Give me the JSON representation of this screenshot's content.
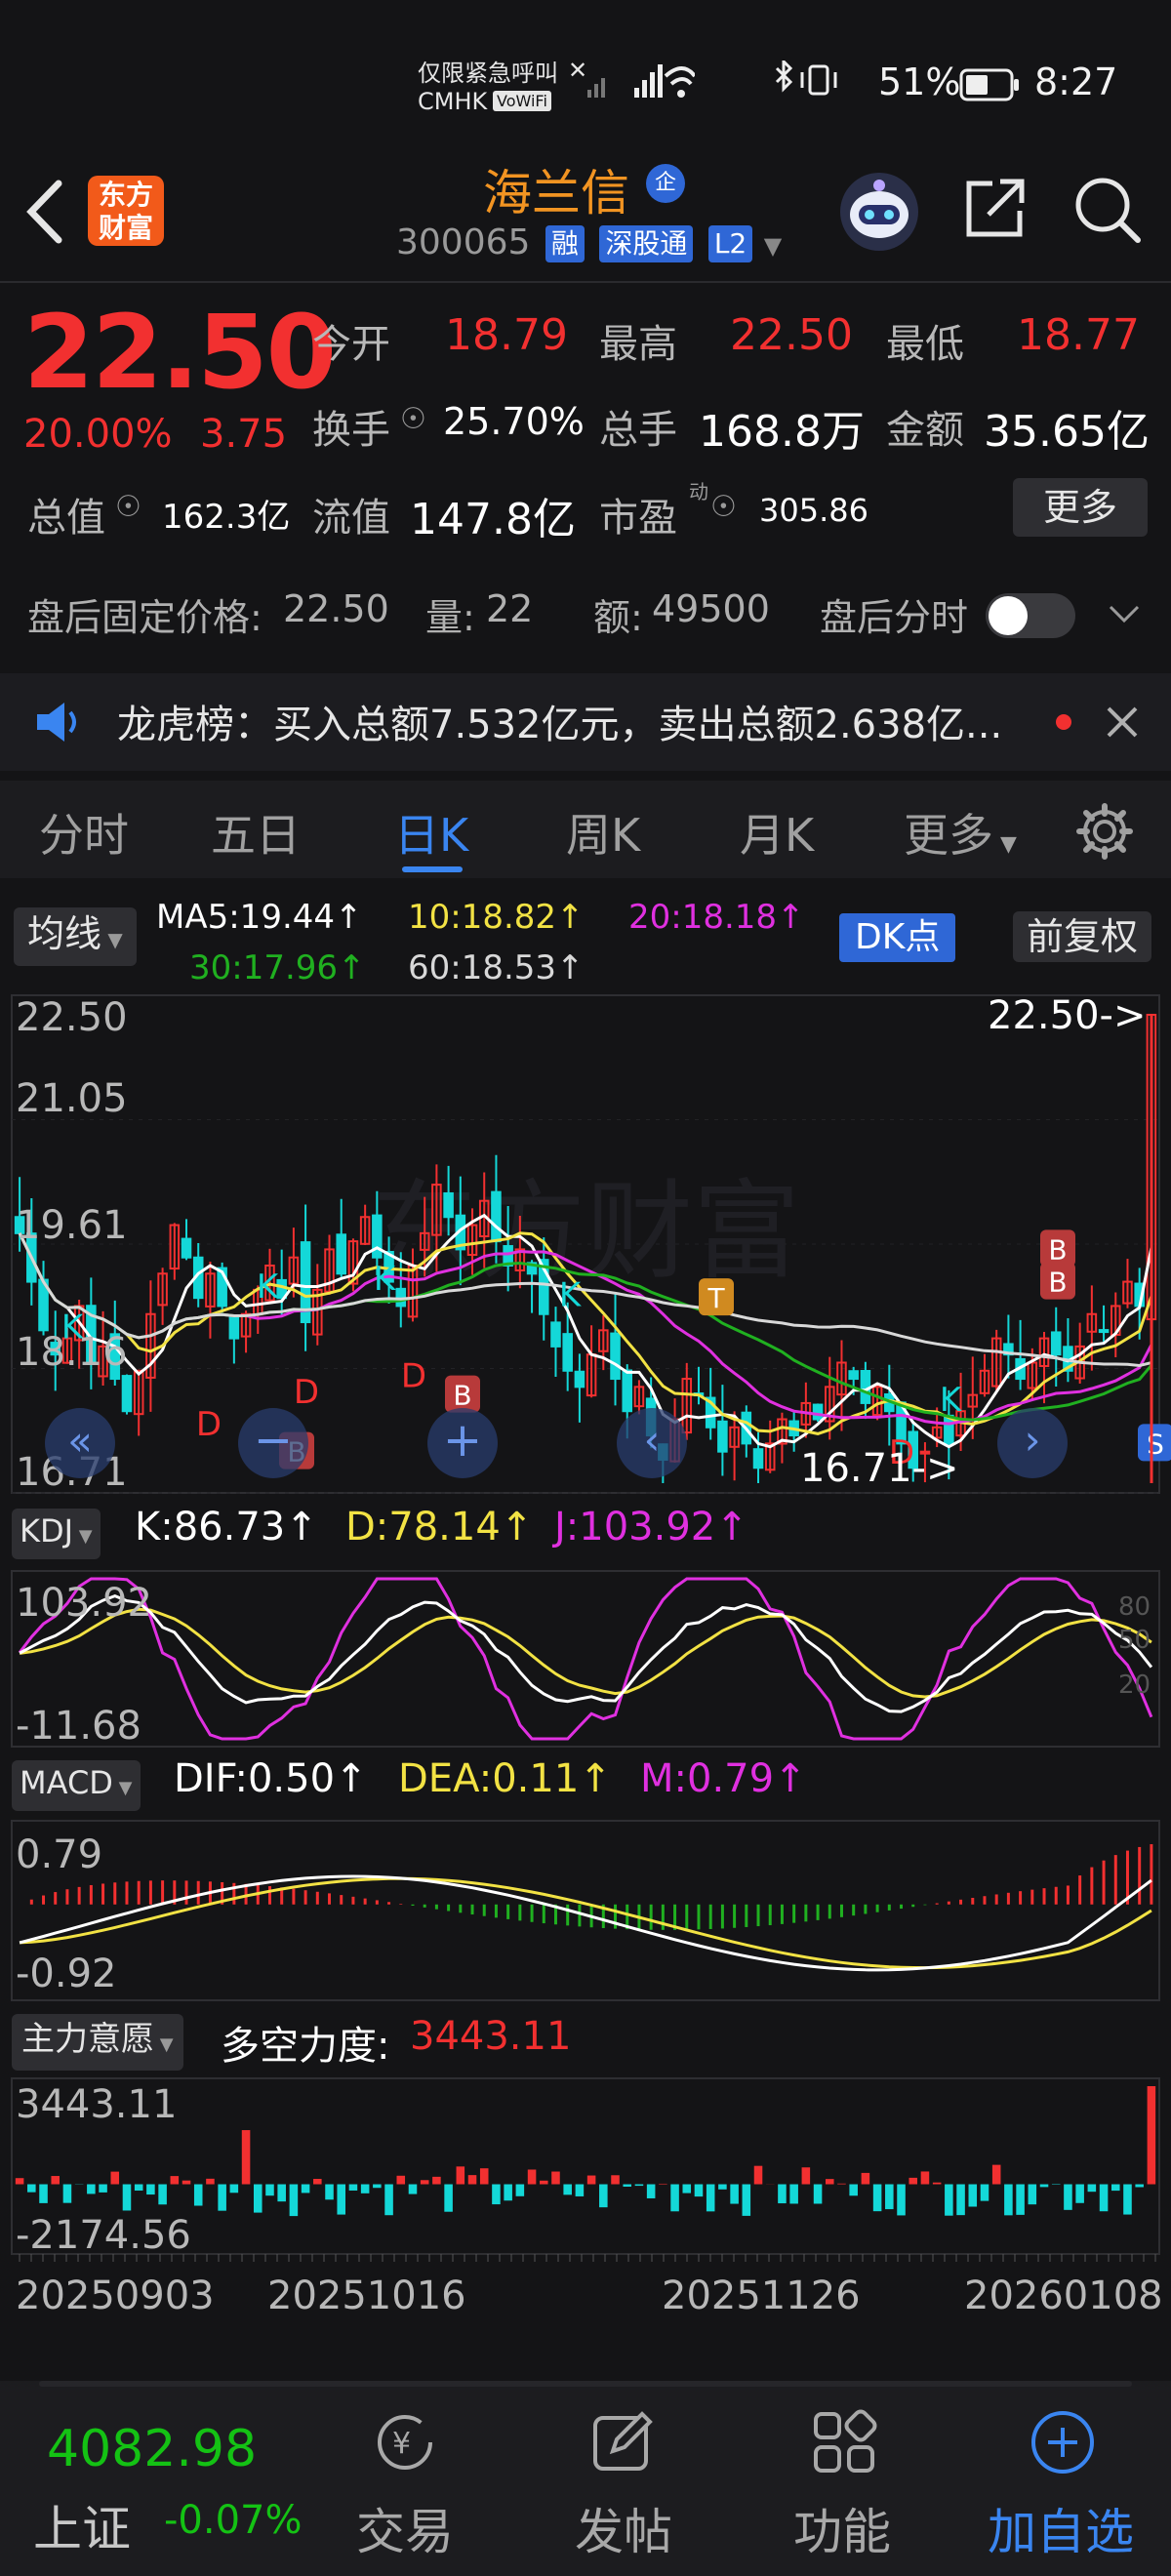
{
  "status_bar": {
    "emergency": "仅限紧急呼叫",
    "carrier": "CMHK",
    "volte": "VoWiFi",
    "battery": "51%",
    "time": "8:27"
  },
  "header": {
    "logo_line1": "东方",
    "logo_line2": "财富",
    "stock_name": "海兰信",
    "badge": "企",
    "code": "300065",
    "tags": [
      "融",
      "深股通",
      "L2"
    ]
  },
  "quote": {
    "price": "22.50",
    "change_pct": "20.00%",
    "change": "3.75",
    "open_label": "今开",
    "open": "18.79",
    "high_label": "最高",
    "high": "22.50",
    "low_label": "最低",
    "low": "18.77",
    "turnover_label": "换手",
    "turnover": "25.70%",
    "volume_label": "总手",
    "volume": "168.8万",
    "amount_label": "金额",
    "amount": "35.65亿",
    "mktcap_label": "总值",
    "mktcap": "162.3亿",
    "float_label": "流值",
    "float": "147.8亿",
    "pe_label": "市盈",
    "pe_sup": "动",
    "pe": "305.86",
    "more": "更多"
  },
  "after_hours": {
    "price_label": "盘后固定价格:",
    "price": "22.50",
    "vol_label": "量:",
    "vol": "22",
    "amt_label": "额:",
    "amt": "49500",
    "toggle_label": "盘后分时"
  },
  "notice": {
    "text": "龙虎榜：买入总额7.532亿元，卖出总额2.638亿..."
  },
  "tabs": [
    "分时",
    "五日",
    "日K",
    "周K",
    "月K",
    "更多"
  ],
  "chart_head": {
    "ma_btn": "均线",
    "ma5": "MA5:19.44↑",
    "ma10": "10:18.82↑",
    "ma20": "20:18.18↑",
    "ma30": "30:17.96↑",
    "ma60": "60:18.53↑",
    "dk_btn": "DK点",
    "fq_btn": "前复权"
  },
  "colors": {
    "up": "#f23030",
    "down": "#14d8d8",
    "ma5": "#ffffff",
    "ma10": "#f2e244",
    "ma20": "#e030e0",
    "ma30": "#20b020",
    "ma60": "#d8d8d8",
    "accent": "#3a85f0"
  },
  "chart_data": [
    {
      "type": "candlestick",
      "ylim": [
        16.71,
        22.5
      ],
      "y_ticks": [
        "22.50",
        "21.05",
        "19.61",
        "18.16",
        "16.71"
      ],
      "annotations": [
        "22.50->",
        "16.71->"
      ],
      "markers": [
        "K",
        "K",
        "K",
        "K",
        "K",
        "D",
        "D",
        "D",
        "D",
        "B",
        "B",
        "B",
        "B",
        "T",
        "S"
      ],
      "series": [
        {
          "name": "MA5",
          "last": 19.44
        },
        {
          "name": "MA10",
          "last": 18.82
        },
        {
          "name": "MA20",
          "last": 18.18
        },
        {
          "name": "MA30",
          "last": 17.96
        },
        {
          "name": "MA60",
          "last": 18.53
        }
      ],
      "closes": [
        19.8,
        19.2,
        18.6,
        18.3,
        18.5,
        18.9,
        18.2,
        18.4,
        18.0,
        17.6,
        18.1,
        18.8,
        19.3,
        19.9,
        19.5,
        19.0,
        19.3,
        18.9,
        18.5,
        18.8,
        19.1,
        19.4,
        19.0,
        19.5,
        18.7,
        19.1,
        19.6,
        19.3,
        19.7,
        20.0,
        19.5,
        19.2,
        18.9,
        19.4,
        19.8,
        20.4,
        20.0,
        19.6,
        19.9,
        20.2,
        19.7,
        19.4,
        19.6,
        19.3,
        18.8,
        18.4,
        18.1,
        17.9,
        18.3,
        18.6,
        18.0,
        17.6,
        17.9,
        17.3,
        17.0,
        17.5,
        18.0,
        17.8,
        17.4,
        17.1,
        17.4,
        17.2,
        16.9,
        17.2,
        17.5,
        17.3,
        17.7,
        17.5,
        17.9,
        18.2,
        18.0,
        17.7,
        17.9,
        17.6,
        17.2,
        16.9,
        17.1,
        17.4,
        17.2,
        17.6,
        17.8,
        18.1,
        18.5,
        18.3,
        18.0,
        18.2,
        18.5,
        18.3,
        18.1,
        18.4,
        18.8,
        18.6,
        18.9,
        19.2,
        18.9,
        22.5
      ]
    },
    {
      "type": "line",
      "title": "KDJ",
      "K": "K:86.73↑",
      "D": "D:78.14↑",
      "J": "J:103.92↑",
      "ylim": [
        -11.68,
        103.92
      ],
      "y_ticks": [
        "103.92",
        "-11.68"
      ],
      "ref_ticks": [
        "80",
        "50",
        "20"
      ]
    },
    {
      "type": "bar",
      "title": "MACD",
      "DIF": "DIF:0.50↑",
      "DEA": "DEA:0.11↑",
      "M": "M:0.79↑",
      "ylim": [
        -0.92,
        0.79
      ],
      "y_ticks": [
        "0.79",
        "-0.92"
      ]
    },
    {
      "type": "bar",
      "title": "主力意愿",
      "label": "多空力度:",
      "value": "3443.11",
      "ylim": [
        -2174.56,
        3443.11
      ],
      "y_ticks": [
        "3443.11",
        "-2174.56"
      ],
      "x_ticks": [
        "20250903",
        "20251016",
        "20251126",
        "20260108"
      ]
    }
  ],
  "bottom_nav": {
    "index_value": "4082.98",
    "index_name": "上证",
    "index_change": "-0.07%",
    "items": [
      "交易",
      "发帖",
      "功能",
      "加自选"
    ]
  }
}
